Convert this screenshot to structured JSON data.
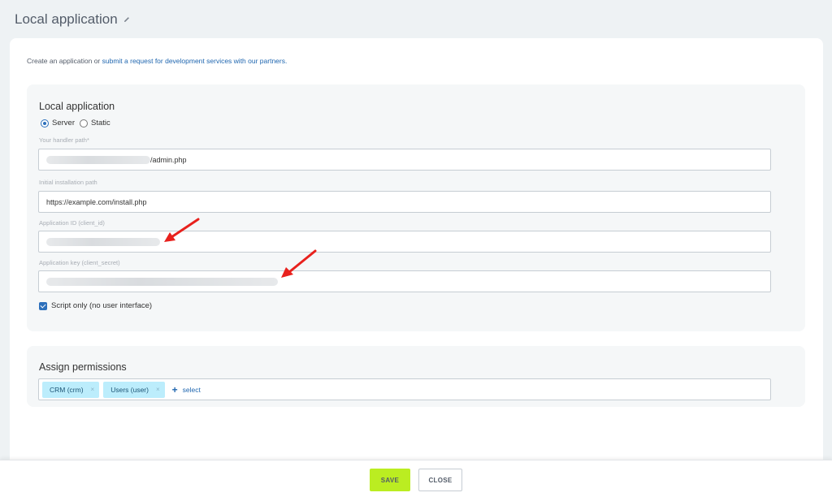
{
  "page": {
    "title": "Local application"
  },
  "intro": {
    "text": "Create an application or ",
    "link": "submit a request for development services with our partners."
  },
  "local_app": {
    "title": "Local application",
    "radio_options": [
      {
        "label": "Server",
        "checked": true
      },
      {
        "label": "Static",
        "checked": false
      }
    ],
    "handler_path": {
      "label": "Your handler path*",
      "value": "/admin.php"
    },
    "install_path": {
      "label": "Initial installation path",
      "value": "https://example.com/install.php"
    },
    "client_id": {
      "label": "Application ID (client_id)",
      "value": ""
    },
    "client_secret": {
      "label": "Application key (client_secret)",
      "value": ""
    },
    "script_only": {
      "label": "Script only (no user interface)",
      "checked": true
    }
  },
  "permissions": {
    "title": "Assign permissions",
    "tags": [
      {
        "label": "CRM (crm)",
        "remove": "×"
      },
      {
        "label": "Users (user)",
        "remove": "×"
      }
    ],
    "add": {
      "icon": "+",
      "label": "select"
    }
  },
  "footer": {
    "save_label": "SAVE",
    "close_label": "CLOSE"
  },
  "colors": {
    "accent": "#2067b0",
    "save": "#bbed21",
    "tag_bg": "#bcedfc",
    "arrow": "#e8211d"
  },
  "icons": {
    "title_edit": "pencil-icon",
    "annotation": "red-arrow-icon"
  }
}
